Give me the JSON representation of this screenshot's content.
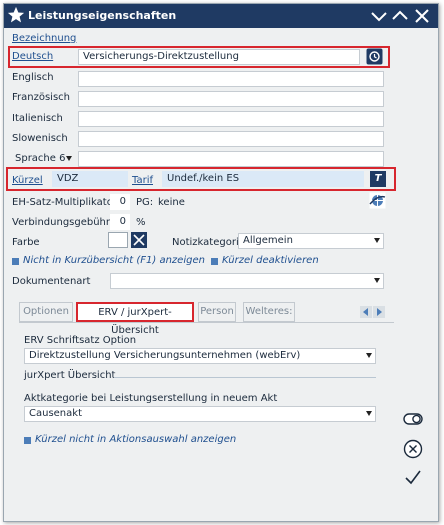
{
  "window": {
    "title": "Leistungseigenschaften"
  },
  "section_link": "Bezeichnung",
  "languages": [
    {
      "label": "Deutsch",
      "value": "Versicherungs-Direktzustellung"
    },
    {
      "label": "Englisch",
      "value": ""
    },
    {
      "label": "Französisch",
      "value": ""
    },
    {
      "label": "Italienisch",
      "value": ""
    },
    {
      "label": "Slowenisch",
      "value": ""
    }
  ],
  "sprache6": {
    "label": "Sprache 6",
    "value": ""
  },
  "kuerzel": {
    "label": "Kürzel",
    "value": "VDZ"
  },
  "tarif": {
    "label": "Tarif",
    "value": "Undef./kein ES",
    "button": "T"
  },
  "eh_satz": {
    "label": "EH-Satz-Multiplikator",
    "value": "0",
    "pg_label": "PG:",
    "pg_value": "keine"
  },
  "verbindung": {
    "label": "Verbindungsgebühr",
    "value": "0",
    "unit": "%"
  },
  "farbe": {
    "label": "Farbe"
  },
  "notiz": {
    "label": "Notizkategorie",
    "value": "Allgemein"
  },
  "checks": {
    "kurzuebersicht": "Nicht in Kurzübersicht (F1) anzeigen",
    "deaktivieren": "Kürzel deaktivieren"
  },
  "dokumentenart": {
    "label": "Dokumentenart",
    "value": ""
  },
  "tabs": [
    "Optionen",
    "ERV / jurXpert-Übersicht",
    "Person",
    "Welteres:"
  ],
  "erv": {
    "option_label": "ERV Schriftsatz Option",
    "option_value": "Direktzustellung Versicherungsunternehmen (webErv)",
    "jurxpert_label": "jurXpert Übersicht",
    "akt_label": "Aktkategorie bei Leistungserstellung in neuem Akt",
    "akt_value": "Causenakt",
    "aktion_check": "Kürzel nicht in Aktionsauswahl anzeigen"
  },
  "colors": {
    "titlebar": "#1f3a63",
    "highlight": "#d7262e",
    "field_blue": "#dbe9f7",
    "accent": "#4c7db8"
  }
}
